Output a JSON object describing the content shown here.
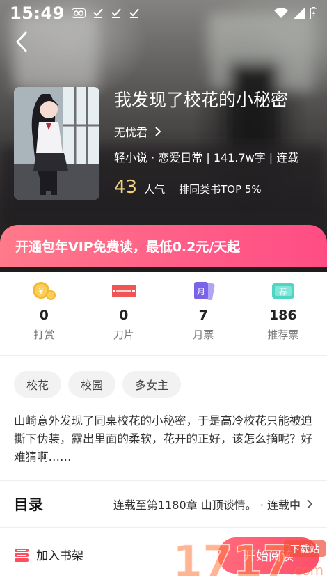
{
  "status_bar": {
    "time": "15:49"
  },
  "book": {
    "title": "我发现了校花的小秘密",
    "author": "无忧君",
    "meta": "轻小说 · 恋爱日常 | 141.7w字 | 连载",
    "popularity_value": "43",
    "popularity_label": "人气",
    "rank": "排同类书TOP 5%"
  },
  "vip_banner": {
    "text": "开通包年VIP免费读，最低0.2元/天起"
  },
  "stats": [
    {
      "icon": "coin-reward-icon",
      "value": "0",
      "label": "打赏"
    },
    {
      "icon": "blade-icon",
      "value": "0",
      "label": "刀片"
    },
    {
      "icon": "monthly-ticket-icon",
      "value": "7",
      "label": "月票",
      "glyph": "月"
    },
    {
      "icon": "recommend-ticket-icon",
      "value": "186",
      "label": "推荐票",
      "glyph": "荐"
    }
  ],
  "tags": [
    "校花",
    "校园",
    "多女主"
  ],
  "description": "山崎意外发现了同桌校花的小秘密，于是高冷校花只能被迫撕下伪装，露出里面的柔软，花开的正好，该怎么摘呢？好难猜啊……",
  "catalog": {
    "title": "目录",
    "info": "连载至第1180章 山顶谈情。 · 连载中"
  },
  "bottom_bar": {
    "shelf_label": "加入书架",
    "read_label": "开始阅读"
  },
  "watermark": {
    "text": "1717",
    "sub": "下载站"
  },
  "colors": {
    "accent": "#ff5c88",
    "popularity": "#f6d37a",
    "read_button": "#ff4e6b"
  }
}
